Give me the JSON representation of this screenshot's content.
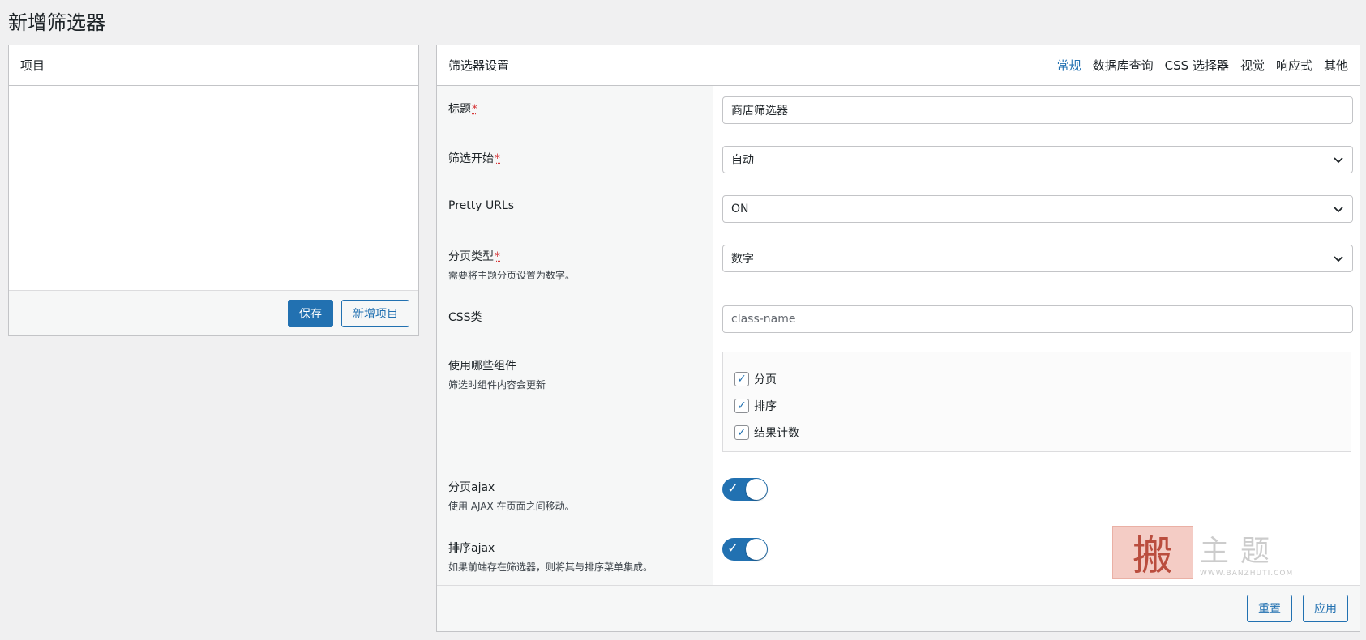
{
  "page": {
    "title": "新增筛选器"
  },
  "items_panel": {
    "title": "项目",
    "save_label": "保存",
    "add_item_label": "新增项目"
  },
  "settings": {
    "title": "筛选器设置",
    "tabs": [
      {
        "label": "常规",
        "active": true
      },
      {
        "label": "数据库查询"
      },
      {
        "label": "CSS 选择器"
      },
      {
        "label": "视觉"
      },
      {
        "label": "响应式"
      },
      {
        "label": "其他"
      }
    ],
    "fields": {
      "title": {
        "label": "标题",
        "required": "*",
        "value": "商店筛选器"
      },
      "filter_start": {
        "label": "筛选开始",
        "required": "*",
        "value": "自动"
      },
      "pretty_urls": {
        "label": "Pretty URLs",
        "value": "ON"
      },
      "pagination_type": {
        "label": "分页类型",
        "required": "*",
        "desc": "需要将主题分页设置为数字。",
        "value": "数字"
      },
      "css_class": {
        "label": "CSS类",
        "placeholder": "class-name"
      },
      "components": {
        "label": "使用哪些组件",
        "desc": "筛选时组件内容会更新",
        "options": [
          {
            "label": "分页",
            "checked": true
          },
          {
            "label": "排序",
            "checked": true
          },
          {
            "label": "结果计数",
            "checked": true
          }
        ]
      },
      "pagination_ajax": {
        "label": "分页ajax",
        "desc": "使用 AJAX 在页面之间移动。",
        "enabled": true
      },
      "sort_ajax": {
        "label": "排序ajax",
        "desc": "如果前端存在筛选器，则将其与排序菜单集成。",
        "enabled": true
      }
    },
    "reset_label": "重置",
    "apply_label": "应用"
  },
  "watermark": {
    "main": "搬主题",
    "url": "WWW.BANZHUTI.COM"
  },
  "colors": {
    "accent": "#2271b1",
    "required": "#d63638",
    "background": "#f0f0f1"
  }
}
